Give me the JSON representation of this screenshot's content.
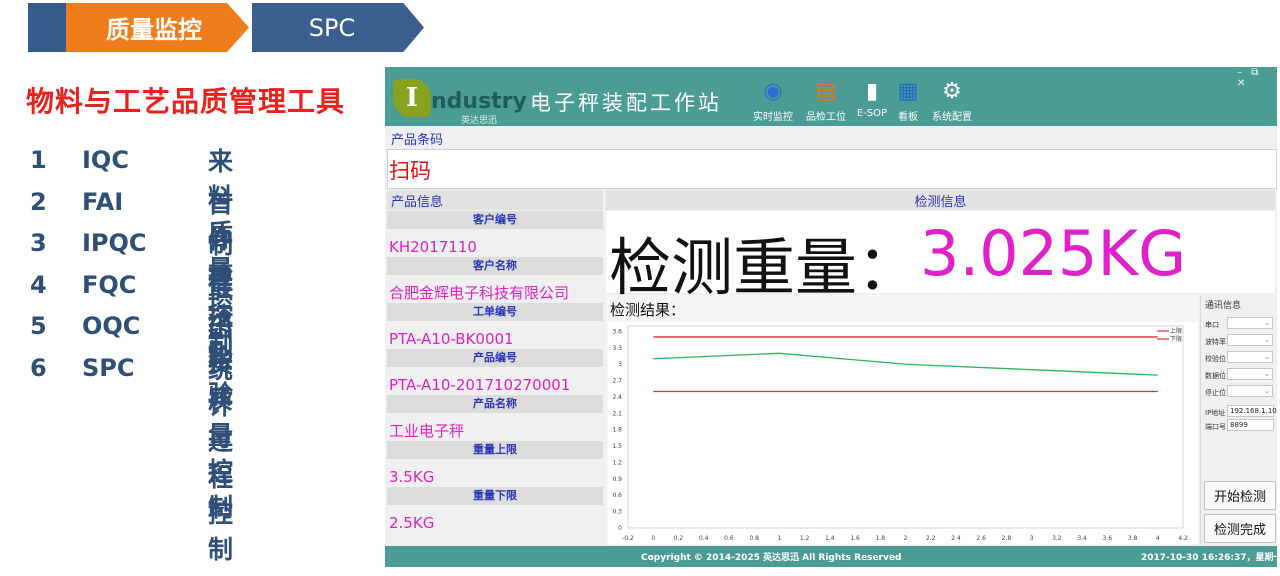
{
  "banner": {
    "tab_active": "质量监控",
    "tab_next": "SPC"
  },
  "left_panel": {
    "title": "物料与工艺品质管理工具",
    "tools": [
      {
        "num": "1",
        "code": "IQC",
        "desc": "来料质量控制"
      },
      {
        "num": "2",
        "code": "FAI",
        "desc": "首件检"
      },
      {
        "num": "3",
        "code": "IPQC",
        "desc": "制程控制"
      },
      {
        "num": "4",
        "code": "FQC",
        "desc": "最终检验"
      },
      {
        "num": "5",
        "code": "OQC",
        "desc": "出货质量控制"
      },
      {
        "num": "6",
        "code": "SPC",
        "desc": "统计过程控制"
      }
    ]
  },
  "app": {
    "logo_letter": "I",
    "logo_text": "ndustry",
    "logo_sub": "英达思迅",
    "title": "电子秤装配工作站",
    "window_controls": "– ⧉ ✕",
    "toolbar": [
      {
        "label": "实时监控",
        "icon": "globe-monitor-icon",
        "glyph": "◉",
        "color": "#2b6fd4"
      },
      {
        "label": "品检工位",
        "icon": "inspection-icon",
        "glyph": "▤",
        "color": "#e8731c"
      },
      {
        "label": "E-SOP",
        "icon": "clipboard-icon",
        "glyph": "▮",
        "color": "#ffffff"
      },
      {
        "label": "看板",
        "icon": "board-icon",
        "glyph": "▦",
        "color": "#1f6fc8"
      },
      {
        "label": "系统配置",
        "icon": "gear-icon",
        "glyph": "⚙",
        "color": "#ffffff"
      }
    ],
    "barcode": {
      "label": "产品条码",
      "value": "扫码"
    },
    "product_info": {
      "header": "产品信息",
      "fields": [
        {
          "label": "客户编号",
          "value": "KH2017110"
        },
        {
          "label": "客户名称",
          "value": "合肥金辉电子科技有限公司"
        },
        {
          "label": "工单编号",
          "value": "PTA-A10-BK0001"
        },
        {
          "label": "产品编号",
          "value": "PTA-A10-201710270001"
        },
        {
          "label": "产品名称",
          "value": "工业电子秤"
        },
        {
          "label": "重量上限",
          "value": "3.5KG"
        },
        {
          "label": "重量下限",
          "value": "2.5KG"
        }
      ]
    },
    "detection": {
      "header": "检测信息",
      "weight_label": "检测重量：",
      "weight_value": "3.025KG",
      "result_label": "检测结果："
    },
    "comm": {
      "title": "通讯信息",
      "rows": [
        {
          "label": "串口",
          "value": ""
        },
        {
          "label": "波特率",
          "value": ""
        },
        {
          "label": "校验位",
          "value": ""
        },
        {
          "label": "数据位",
          "value": ""
        },
        {
          "label": "停止位",
          "value": ""
        }
      ],
      "ip_label": "IP地址",
      "ip_value": "192.168.1.102",
      "port_label": "端口号",
      "port_value": "8899",
      "start_button": "开始检测",
      "finish_button": "检测完成"
    },
    "footer": {
      "copyright": "Copyright © 2014-2025 英达思迅  All Rights Reserved",
      "datetime": "2017-10-30 16:26:37，星期一"
    }
  },
  "chart_data": {
    "type": "line",
    "x_ticks": [
      "-0.2",
      "0",
      "0.2",
      "0.4",
      "0.6",
      "0.8",
      "1",
      "1.2",
      "1.4",
      "1.6",
      "1.8",
      "2",
      "2.2",
      "2.4",
      "2.6",
      "2.8",
      "3",
      "3.2",
      "3.4",
      "3.6",
      "3.8",
      "4",
      "4.2"
    ],
    "y_ticks": [
      "0",
      "0.3",
      "0.6",
      "0.9",
      "1.2",
      "1.5",
      "1.8",
      "2.1",
      "2.4",
      "2.7",
      "3",
      "3.3",
      "3.6"
    ],
    "xlim": [
      -0.2,
      4.2
    ],
    "ylim": [
      0,
      3.7
    ],
    "series": [
      {
        "name": "上限",
        "color": "#e03030",
        "x": [
          0,
          4
        ],
        "y": [
          3.5,
          3.5
        ]
      },
      {
        "name": "下限",
        "color": "#e03030",
        "x": [
          0,
          4
        ],
        "y": [
          2.5,
          2.5
        ]
      },
      {
        "name": "",
        "color": "#2bb55a",
        "x": [
          0,
          1,
          2,
          3,
          4
        ],
        "y": [
          3.1,
          3.2,
          3.0,
          2.9,
          2.8
        ]
      }
    ],
    "legend": "top-right",
    "grid": false
  }
}
